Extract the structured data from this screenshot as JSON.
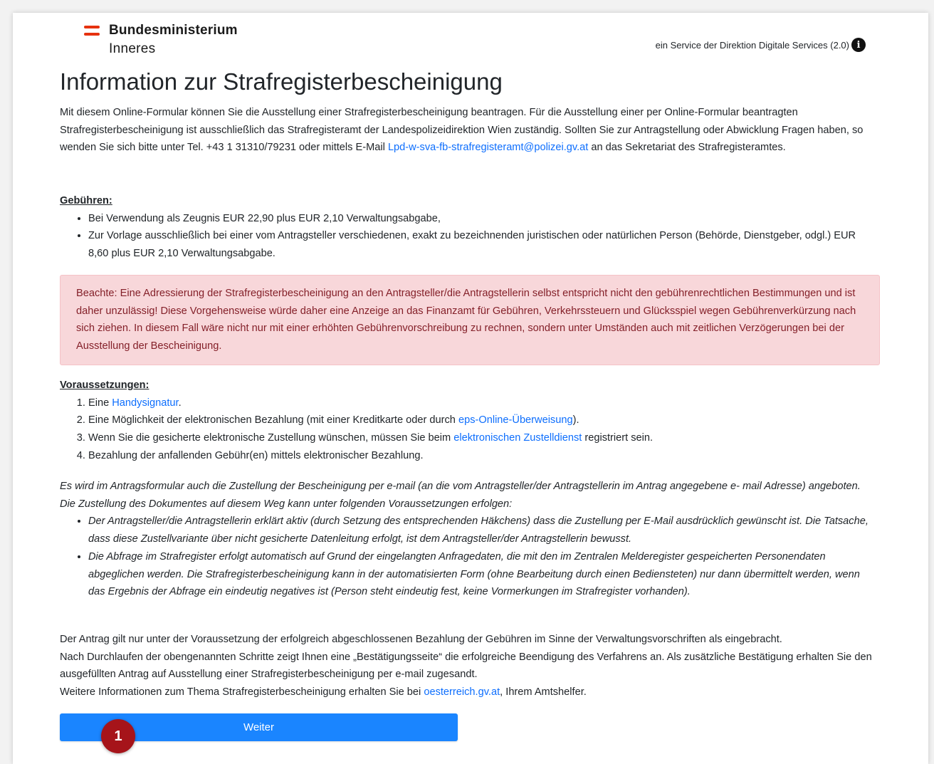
{
  "header": {
    "logo_line1": "Bundesministerium",
    "logo_line2": "Inneres",
    "service_text": "ein Service der Direktion Digitale Services (2.0)",
    "info_icon": "i"
  },
  "page_title": "Information zur Strafregisterbescheinigung",
  "intro": {
    "text_before": "Mit diesem Online-Formular können Sie die Ausstellung einer Strafregisterbescheinigung beantragen. Für die Ausstellung einer per Online-Formular beantragten Strafregisterbescheinigung ist ausschließlich das Strafregisteramt der Landespolizeidirektion Wien zuständig. Sollten Sie zur Antragstellung oder Abwicklung Fragen haben, so wenden Sie sich bitte unter Tel. +43 1 31310/79231 oder mittels E-Mail ",
    "email_link": "Lpd-w-sva-fb-strafregisteramt@polizei.gv.at",
    "text_after": " an das Sekretariat des Strafregisteramtes."
  },
  "fees": {
    "heading": "Gebühren:",
    "items": [
      "Bei Verwendung als Zeugnis EUR 22,90 plus EUR 2,10 Verwaltungsabgabe,",
      "Zur Vorlage ausschließlich bei einer vom Antragsteller verschiedenen, exakt zu bezeichnenden juristischen oder natürlichen Person (Behörde, Dienstgeber, odgl.) EUR 8,60 plus EUR 2,10 Verwaltungsabgabe."
    ]
  },
  "alert": {
    "text": "Beachte: Eine Adressierung der Strafregisterbescheinigung an den Antragsteller/die Antragstellerin selbst entspricht nicht den gebührenrechtlichen Bestimmungen und ist daher unzulässig! Diese Vorgehensweise würde daher eine Anzeige an das Finanzamt für Gebühren, Verkehrssteuern und Glücksspiel wegen Gebührenverkürzung nach sich ziehen. In diesem Fall wäre nicht nur mit einer erhöhten Gebührenvorschreibung zu rechnen, sondern unter Umständen auch mit zeitlichen Verzögerungen bei der Ausstellung der Bescheinigung."
  },
  "prereq": {
    "heading": "Voraussetzungen:",
    "item1_before": "Eine ",
    "item1_link": "Handysignatur",
    "item1_after": ".",
    "item2_before": "Eine Möglichkeit der elektronischen Bezahlung (mit einer Kreditkarte oder durch ",
    "item2_link": "eps-Online-Überweisung",
    "item2_after": ").",
    "item3_before": "Wenn Sie die gesicherte elektronische Zustellung wünschen, müssen Sie beim ",
    "item3_link": "elektronischen Zustelldienst",
    "item3_after": " registriert sein.",
    "item4": "Bezahlung der anfallenden Gebühr(en) mittels elektronischer Bezahlung."
  },
  "email_info": {
    "text": "Es wird im Antragsformular auch die Zustellung der Bescheinigung per e-mail (an die vom Antragsteller/der Antragstellerin im Antrag angegebene e- mail Adresse) angeboten. Die Zustellung des Dokumentes auf diesem Weg kann unter folgenden Voraussetzungen erfolgen:",
    "items": [
      "Der Antragsteller/die Antragstellerin erklärt aktiv (durch Setzung des entsprechenden Häkchens) dass die Zustellung per E-Mail ausdrücklich gewünscht ist. Die Tatsache, dass diese Zustellvariante über nicht gesicherte Datenleitung erfolgt, ist dem Antragsteller/der Antragstellerin bewusst.",
      "Die Abfrage im Strafregister erfolgt automatisch auf Grund der eingelangten Anfragedaten, die mit den im Zentralen Melderegister gespeicherten Personendaten abgeglichen werden. Die Strafregisterbescheinigung kann in der automatisierten Form (ohne Bearbeitung durch einen Bediensteten) nur dann übermittelt werden, wenn das Ergebnis der Abfrage ein eindeutig negatives ist (Person steht eindeutig fest, keine Vormerkungen im Strafregister vorhanden)."
    ]
  },
  "closing": {
    "line1": "Der Antrag gilt nur unter der Voraussetzung der erfolgreich abgeschlossenen Bezahlung der Gebühren im Sinne der Verwaltungsvorschriften als eingebracht.",
    "line2": "Nach Durchlaufen der obengenannten Schritte zeigt Ihnen eine „Bestätigungsseite“ die erfolgreiche Beendigung des Verfahrens an. Als zusätzliche Bestätigung erhalten Sie den ausgefüllten Antrag auf Ausstellung einer Strafregisterbescheinigung per e-mail zugesandt.",
    "line3_before": "Weitere Informationen zum Thema Strafregisterbescheinigung erhalten Sie bei ",
    "line3_link": "oesterreich.gv.at",
    "line3_after": ", Ihrem Amtshelfer."
  },
  "button": {
    "label": "Weiter"
  },
  "step_badge": "1",
  "colors": {
    "primary": "#1a85ff",
    "link": "#0d6efd",
    "alert_bg": "#f8d7da",
    "alert_text": "#842029",
    "badge": "#a6141a",
    "flag": "#e6320f"
  }
}
